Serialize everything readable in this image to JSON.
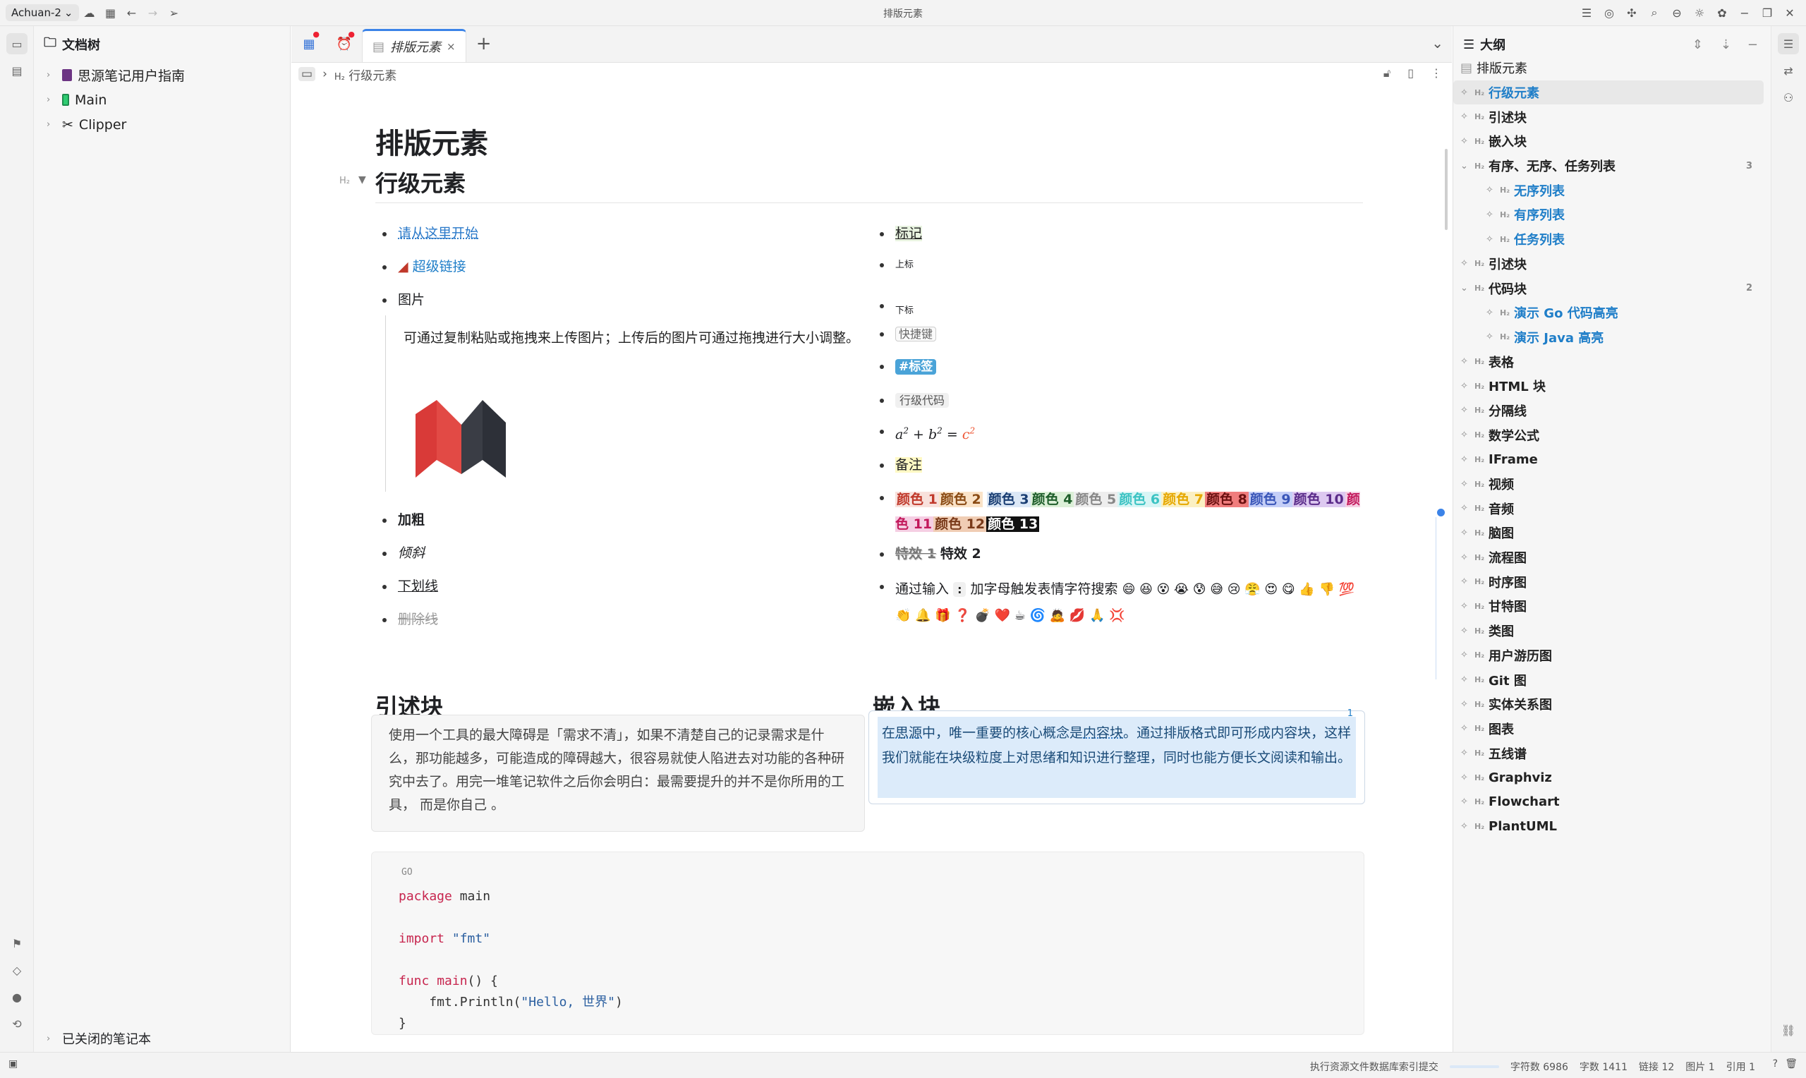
{
  "app": {
    "workspace": "Achuan-2",
    "window_title": "排版元素"
  },
  "filetree": {
    "title": "文档树",
    "items": [
      {
        "icon": "book-purple-icon",
        "label": "思源笔记用户指南"
      },
      {
        "icon": "battery-icon",
        "label": "Main"
      },
      {
        "icon": "scissors-icon",
        "label": "Clipper"
      }
    ],
    "closed_label": "已关闭的笔记本"
  },
  "tabs": {
    "active_label": "排版元素",
    "close": "×",
    "add": "+"
  },
  "breadcrumb": {
    "heading_tag": "H₂",
    "label": "行级元素"
  },
  "doc": {
    "title": "排版元素",
    "h2_mark": "H₂",
    "section1": "行级元素",
    "left_list": {
      "start_here": "请从这里开始",
      "hyperlink": "超级链接",
      "image": "图片",
      "image_desc": "可通过复制粘贴或拖拽来上传图片；上传后的图片可通过拖拽进行大小调整。",
      "bold": "加粗",
      "italic": "倾斜",
      "underline": "下划线",
      "strike": "删除线"
    },
    "right_list": {
      "mark": "标记",
      "sup": "上标",
      "sub": "下标",
      "kbd": "快捷键",
      "tag": "#标签",
      "inline_code": "行级代码",
      "math_a": "a",
      "math_b": "b",
      "math_c": "c",
      "math_exp": "2",
      "math_op": "+",
      "math_eq": "=",
      "note": "备注",
      "colors": [
        "颜色 1",
        "颜色 2",
        "颜色 3",
        "颜色 4",
        "颜色 5",
        "颜色 6",
        "颜色 7",
        "颜色 8",
        "颜色 9",
        "颜色 10",
        "颜色 11",
        "颜色 12",
        "颜色 13"
      ],
      "effect1": "特效 1",
      "effect2": "特效 2",
      "emoji_intro": "通过输入",
      "emoji_colon": ":",
      "emoji_tail": "加字母触发表情字符搜索",
      "emojis": "😄 😆 😵 😭 😰 😅 😢 😤 😍 😋 👍 👎 💯 👏 🔔 🎁 ❓ 💣 ❤️ ☕ 🌀 🙇 💋 🙏 💢"
    },
    "quote_title": "引述块",
    "quote_text": "使用一个工具的最大障碍是「需求不清」，如果不清楚自己的记录需求是什么，那功能越多，可能造成的障碍越大，很容易就使人陷进去对功能的各种研究中去了。用完一堆笔记软件之后你会明白：最需要提升的并不是你所用的工具， 而是你自己 。",
    "embed_title": "嵌入块",
    "embed_count": "1",
    "embed_pre": "在",
    "embed_link1": "思源",
    "embed_mid": "中，唯一重要的核心概念是",
    "embed_link2": "内容块",
    "embed_post": "。通过排版格式即可形成内容块，这样我们就能在块级粒度上对思绪和知识进行整理，同时也能方便长文阅读和输出。",
    "code": {
      "lang": "GO",
      "l1_kw": "package",
      "l1_rest": " main",
      "l2_kw": "import",
      "l2_str": " \"fmt\"",
      "l3_kw": "func",
      "l3_fn": " main",
      "l3_rest": "() {",
      "l4_pre": "    fmt.Println(",
      "l4_str": "\"Hello, 世界\"",
      "l4_post": ")",
      "l5": "}"
    }
  },
  "outline": {
    "title": "大纲",
    "root": "排版元素",
    "items": [
      {
        "label": "行级元素",
        "level": 1,
        "active": true
      },
      {
        "label": "引述块",
        "level": 1
      },
      {
        "label": "嵌入块",
        "level": 1
      },
      {
        "label": "有序、无序、任务列表",
        "level": 1,
        "count": "3",
        "expanded": true
      },
      {
        "label": "无序列表",
        "level": 2
      },
      {
        "label": "有序列表",
        "level": 2
      },
      {
        "label": "任务列表",
        "level": 2
      },
      {
        "label": "引述块",
        "level": 1
      },
      {
        "label": "代码块",
        "level": 1,
        "count": "2",
        "expanded": true
      },
      {
        "label": "演示 Go 代码高亮",
        "level": 2
      },
      {
        "label": "演示 Java 高亮",
        "level": 2
      },
      {
        "label": "表格",
        "level": 1
      },
      {
        "label": "HTML 块",
        "level": 1
      },
      {
        "label": "分隔线",
        "level": 1
      },
      {
        "label": "数学公式",
        "level": 1
      },
      {
        "label": "IFrame",
        "level": 1
      },
      {
        "label": "视频",
        "level": 1
      },
      {
        "label": "音频",
        "level": 1
      },
      {
        "label": "脑图",
        "level": 1
      },
      {
        "label": "流程图",
        "level": 1
      },
      {
        "label": "时序图",
        "level": 1
      },
      {
        "label": "甘特图",
        "level": 1
      },
      {
        "label": "类图",
        "level": 1
      },
      {
        "label": "用户游历图",
        "level": 1
      },
      {
        "label": "Git 图",
        "level": 1
      },
      {
        "label": "实体关系图",
        "level": 1
      },
      {
        "label": "图表",
        "level": 1
      },
      {
        "label": "五线谱",
        "level": 1
      },
      {
        "label": "Graphviz",
        "level": 1
      },
      {
        "label": "Flowchart",
        "level": 1
      },
      {
        "label": "PlantUML",
        "level": 1
      }
    ]
  },
  "status": {
    "task": "执行资源文件数据库索引提交",
    "chars": "字符数 6986",
    "words": "字数 1411",
    "links": "链接 12",
    "images": "图片 1",
    "refs": "引用 1"
  },
  "colors": {
    "accent": "#3b83e8",
    "link": "#1f7ec8"
  }
}
